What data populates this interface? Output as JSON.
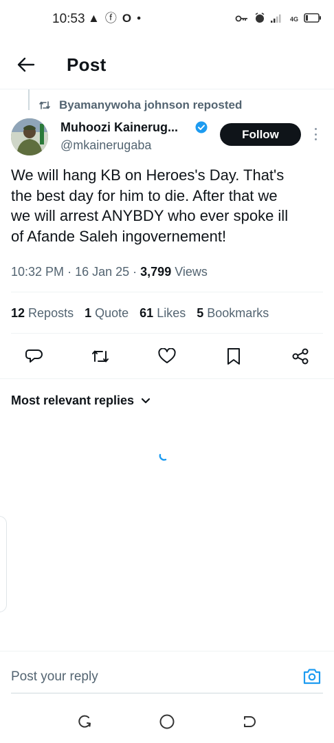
{
  "status_bar": {
    "time": "10:53",
    "left_icons": [
      "▲",
      "ⓕ",
      "O",
      "•"
    ],
    "network": "4G"
  },
  "header": {
    "title": "Post",
    "back_icon": "arrow-left-icon"
  },
  "post": {
    "reposted_by": "Byamanywoha johnson reposted",
    "author_name": "Muhoozi Kainerug...",
    "author_handle": "@mkainerugaba",
    "follow_label": "Follow",
    "text": "We will hang KB on Heroes's Day. That's\nthe best day for him to die.  After that we\nwe will arrest ANYBDY who ever spoke ill\nof  Afande Saleh ingovernement!",
    "time": "10:32 PM",
    "date": "16 Jan 25",
    "views_count": "3,799",
    "views_label": "Views"
  },
  "stats": {
    "reposts_count": "12",
    "reposts_label": "Reposts",
    "quotes_count": "1",
    "quotes_label": "Quote",
    "likes_count": "61",
    "likes_label": "Likes",
    "bookmarks_count": "5",
    "bookmarks_label": "Bookmarks"
  },
  "replies": {
    "sort_label": "Most relevant replies"
  },
  "reply_bar": {
    "placeholder": "Post your reply"
  },
  "colors": {
    "accent": "#1d9bf0",
    "text_primary": "#0f1419",
    "text_secondary": "#536471",
    "divider": "#eff3f4",
    "follow_bg": "#0f1419"
  }
}
